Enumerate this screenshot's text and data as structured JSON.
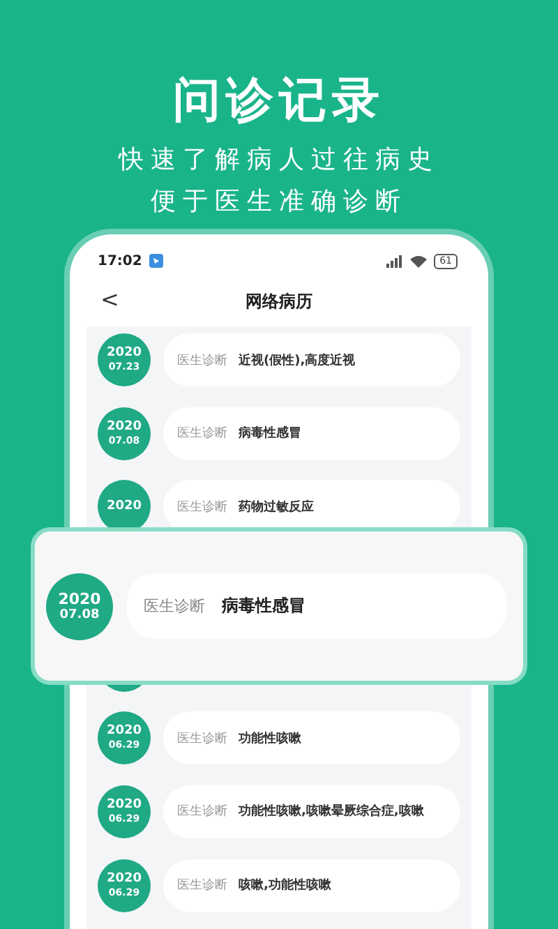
{
  "headline": "问诊记录",
  "subtitles": [
    "快速了解病人过往病史",
    "便于医生准确诊断"
  ],
  "status_bar": {
    "time": "17:02",
    "battery": "61"
  },
  "nav": {
    "back": "<",
    "title": "网络病历"
  },
  "records": [
    {
      "kind": "record",
      "year": "2020",
      "date": "07.23",
      "label": "医生诊断",
      "diagnosis": "近视(假性),高度近视"
    },
    {
      "kind": "record",
      "year": "2020",
      "date": "07.08",
      "label": "医生诊断",
      "diagnosis": "病毒性感冒"
    },
    {
      "kind": "record",
      "year": "2020",
      "label": "医生诊断",
      "diagnosis": "药物过敏反应"
    },
    {
      "kind": "covered"
    },
    {
      "kind": "record",
      "year": "2020",
      "date": "06.29",
      "label": "医生诊断",
      "diagnosis": "功能性咳嗽"
    },
    {
      "kind": "record",
      "year": "2020",
      "date": "06.29",
      "label": "医生诊断",
      "diagnosis": "功能性咳嗽,咳嗽晕厥综合症,咳嗽"
    },
    {
      "kind": "record",
      "year": "2020",
      "date": "06.29",
      "label": "医生诊断",
      "diagnosis": "咳嗽,功能性咳嗽"
    }
  ],
  "highlight": {
    "year": "2020",
    "date": "07.08",
    "label": "医生诊断",
    "diagnosis": "病毒性感冒"
  }
}
